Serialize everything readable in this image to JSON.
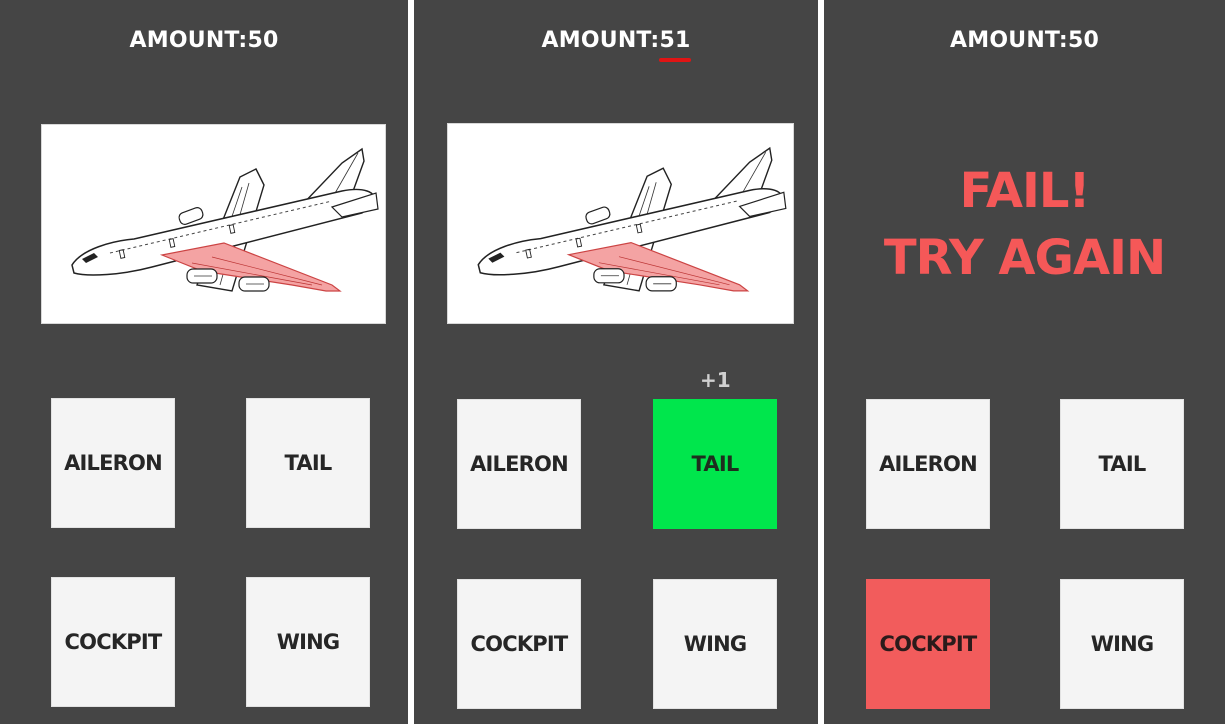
{
  "panels": [
    {
      "amount_label": "AMOUNT:",
      "amount_value": "50",
      "buttons": [
        {
          "label": "AILERON",
          "state": "neutral"
        },
        {
          "label": "TAIL",
          "state": "neutral"
        },
        {
          "label": "COCKPIT",
          "state": "neutral"
        },
        {
          "label": "WING",
          "state": "neutral"
        }
      ]
    },
    {
      "amount_label": "AMOUNT:",
      "amount_value": "51",
      "score_delta": "+1",
      "buttons": [
        {
          "label": "AILERON",
          "state": "neutral"
        },
        {
          "label": "TAIL",
          "state": "correct"
        },
        {
          "label": "COCKPIT",
          "state": "neutral"
        },
        {
          "label": "WING",
          "state": "neutral"
        }
      ]
    },
    {
      "amount_label": "AMOUNT:",
      "amount_value": "50",
      "message_line1": "FAIL!",
      "message_line2": "TRY AGAIN",
      "buttons": [
        {
          "label": "AILERON",
          "state": "neutral"
        },
        {
          "label": "TAIL",
          "state": "neutral"
        },
        {
          "label": "COCKPIT",
          "state": "wrong"
        },
        {
          "label": "WING",
          "state": "neutral"
        }
      ]
    }
  ],
  "colors": {
    "background": "#454545",
    "correct": "#00e64c",
    "wrong": "#f25c5c",
    "fail_text": "#f55858",
    "highlight_wing": "#f4a3a3"
  },
  "icons": [
    "airplane-illustration",
    "score-underline"
  ]
}
